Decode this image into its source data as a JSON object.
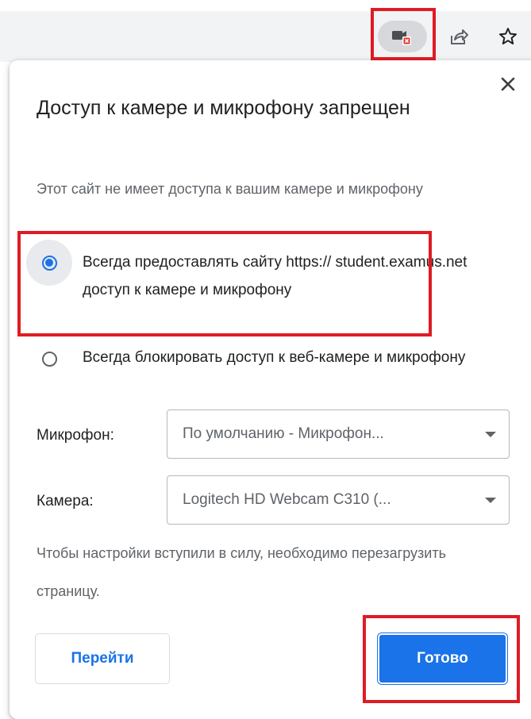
{
  "toolbar": {
    "camera_blocked_icon": "camera-blocked-icon",
    "share_icon": "share-icon",
    "bookmark_icon": "star-icon"
  },
  "dialog": {
    "title": "Доступ к камере и микрофону запрещен",
    "subtitle": "Этот сайт не имеет доступа к вашим камере и микрофону",
    "close_icon": "close-icon",
    "options": [
      {
        "label": "Всегда предоставлять сайту https:// student.examus.net доступ к камере и микрофону",
        "checked": true
      },
      {
        "label": "Всегда блокировать доступ к веб-камере и микрофону",
        "checked": false
      }
    ],
    "microphone": {
      "label": "Микрофон:",
      "value": "По умолчанию - Микрофон..."
    },
    "camera": {
      "label": "Камера:",
      "value": "Logitech HD Webcam C310 (..."
    },
    "note": "Чтобы настройки вступили в силу, необходимо перезагрузить страницу.",
    "buttons": {
      "go": "Перейти",
      "done": "Готово"
    }
  },
  "colors": {
    "accent": "#1a73e8",
    "highlight": "#e01b24",
    "text": "#202124",
    "secondary": "#5f6368"
  }
}
